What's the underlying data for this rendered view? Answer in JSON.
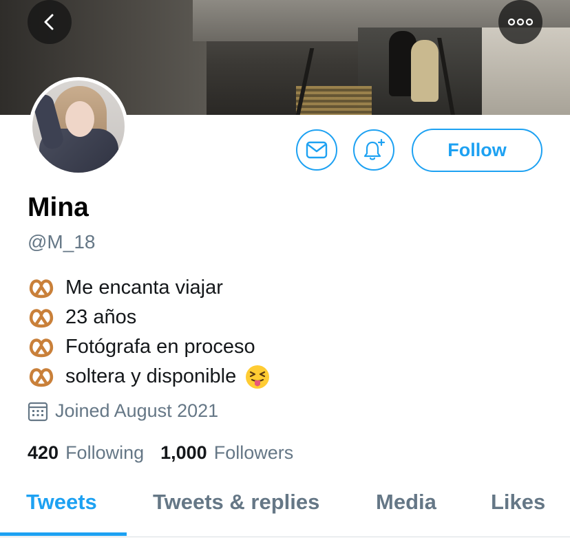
{
  "header": {
    "back_icon": "chevron-left-icon",
    "more_icon": "more-horizontal-icon"
  },
  "profile": {
    "name": "Mina",
    "handle": "@M_18",
    "bio": [
      {
        "icon": "pretzel-icon",
        "text": "Me encanta viajar"
      },
      {
        "icon": "pretzel-icon",
        "text": "23 años"
      },
      {
        "icon": "pretzel-icon",
        "text": "Fotógrafa en proceso"
      },
      {
        "icon": "pretzel-icon",
        "text": "soltera y disponible",
        "trailing_icon": "squinting-tongue-face-icon"
      }
    ],
    "joined": "Joined August 2021",
    "following_count": "420",
    "following_label": "Following",
    "followers_count": "1,000",
    "followers_label": "Followers"
  },
  "actions": {
    "message_icon": "mail-icon",
    "notify_icon": "bell-plus-icon",
    "follow_label": "Follow"
  },
  "tabs": [
    {
      "label": "Tweets",
      "active": true
    },
    {
      "label": "Tweets & replies",
      "active": false
    },
    {
      "label": "Media",
      "active": false
    },
    {
      "label": "Likes",
      "active": false
    }
  ],
  "colors": {
    "accent": "#1da1f2",
    "secondary_text": "#657786",
    "primary_text": "#14171a"
  }
}
